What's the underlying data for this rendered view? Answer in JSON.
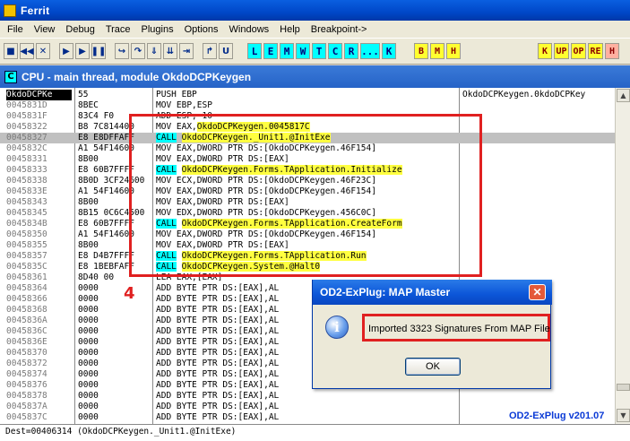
{
  "window": {
    "title": "Ferrit"
  },
  "menu": [
    "File",
    "View",
    "Debug",
    "Trace",
    "Plugins",
    "Options",
    "Windows",
    "Help",
    "Breakpoint->"
  ],
  "toolbar": {
    "letters": [
      "L",
      "E",
      "M",
      "W",
      "T",
      "C",
      "R",
      "...",
      "K"
    ],
    "letters2": [
      "B",
      "M",
      "H"
    ],
    "plugins": [
      "K",
      "UP",
      "OP",
      "RE",
      "H"
    ]
  },
  "cpu": {
    "caption": "CPU - main thread, module OkdoDCPKeygen",
    "rows": [
      {
        "addr": "OkdoDCPKe",
        "hex": "55",
        "asm": "PUSH EBP",
        "cmt": "OkdoDCPKeygen.0kdoDCPKey"
      },
      {
        "addr": "0045831D",
        "hex": "8BEC",
        "asm": "MOV EBP,ESP"
      },
      {
        "addr": "0045831F",
        "hex": "83C4 F0",
        "asm": "ADD ESP,-10"
      },
      {
        "addr": "00458322",
        "hex": "B8 7C814400",
        "asm_pre": "MOV EAX,",
        "asm_tgt": "OkdoDCPKeygen.0045817C"
      },
      {
        "addr": "00458327",
        "hex": "E8 E8DFFAFF",
        "asm_kw": "CALL",
        "asm_tgt": "OkdoDCPKeygen._Unit1.@InitExe"
      },
      {
        "addr": "0045832C",
        "hex": "A1 54F14600",
        "asm": "MOV EAX,DWORD PTR DS:[OkdoDCPKeygen.46F154]"
      },
      {
        "addr": "00458331",
        "hex": "8B00",
        "asm": "MOV EAX,DWORD PTR DS:[EAX]"
      },
      {
        "addr": "00458333",
        "hex": "E8 60B7FFFF",
        "asm_kw": "CALL",
        "asm_tgt": "OkdoDCPKeygen.Forms.TApplication.Initialize"
      },
      {
        "addr": "00458338",
        "hex": "8B0D 3CF24600",
        "asm": "MOV ECX,DWORD PTR DS:[OkdoDCPKeygen.46F23C]"
      },
      {
        "addr": "0045833E",
        "hex": "A1 54F14600",
        "asm": "MOV EAX,DWORD PTR DS:[OkdoDCPKeygen.46F154]"
      },
      {
        "addr": "00458343",
        "hex": "8B00",
        "asm": "MOV EAX,DWORD PTR DS:[EAX]"
      },
      {
        "addr": "00458345",
        "hex": "8B15 0C6C4500",
        "asm": "MOV EDX,DWORD PTR DS:[OkdoDCPKeygen.456C0C]"
      },
      {
        "addr": "0045834B",
        "hex": "E8 60B7FFFF",
        "asm_kw": "CALL",
        "asm_tgt": "OkdoDCPKeygen.Forms.TApplication.CreateForm"
      },
      {
        "addr": "00458350",
        "hex": "A1 54F14600",
        "asm": "MOV EAX,DWORD PTR DS:[OkdoDCPKeygen.46F154]"
      },
      {
        "addr": "00458355",
        "hex": "8B00",
        "asm": "MOV EAX,DWORD PTR DS:[EAX]"
      },
      {
        "addr": "00458357",
        "hex": "E8 D4B7FFFF",
        "asm_kw": "CALL",
        "asm_tgt": "OkdoDCPKeygen.Forms.TApplication.Run"
      },
      {
        "addr": "0045835C",
        "hex": "E8 1BEBFAFF",
        "asm_kw": "CALL",
        "asm_tgt": "OkdoDCPKeygen.System.@Halt0"
      },
      {
        "addr": "00458361",
        "hex": "8D40 00",
        "asm": "LEA EAX,[EAX]"
      },
      {
        "addr": "00458364",
        "hex": "0000",
        "asm": "ADD BYTE PTR DS:[EAX],AL"
      },
      {
        "addr": "00458366",
        "hex": "0000",
        "asm": "ADD BYTE PTR DS:[EAX],AL"
      },
      {
        "addr": "00458368",
        "hex": "0000",
        "asm": "ADD BYTE PTR DS:[EAX],AL"
      },
      {
        "addr": "0045836A",
        "hex": "0000",
        "asm": "ADD BYTE PTR DS:[EAX],AL"
      },
      {
        "addr": "0045836C",
        "hex": "0000",
        "asm": "ADD BYTE PTR DS:[EAX],AL"
      },
      {
        "addr": "0045836E",
        "hex": "0000",
        "asm": "ADD BYTE PTR DS:[EAX],AL"
      },
      {
        "addr": "00458370",
        "hex": "0000",
        "asm": "ADD BYTE PTR DS:[EAX],AL"
      },
      {
        "addr": "00458372",
        "hex": "0000",
        "asm": "ADD BYTE PTR DS:[EAX],AL"
      },
      {
        "addr": "00458374",
        "hex": "0000",
        "asm": "ADD BYTE PTR DS:[EAX],AL"
      },
      {
        "addr": "00458376",
        "hex": "0000",
        "asm": "ADD BYTE PTR DS:[EAX],AL"
      },
      {
        "addr": "00458378",
        "hex": "0000",
        "asm": "ADD BYTE PTR DS:[EAX],AL"
      },
      {
        "addr": "0045837A",
        "hex": "0000",
        "asm": "ADD BYTE PTR DS:[EAX],AL"
      },
      {
        "addr": "0045837C",
        "hex": "0000",
        "asm": "ADD BYTE PTR DS:[EAX],AL"
      }
    ],
    "status": "Dest=00406314 (OkdoDCPKeygen._Unit1.@InitExe)"
  },
  "annotation": {
    "number": "4"
  },
  "dialog": {
    "title": "OD2-ExPlug: MAP Master",
    "message": "Imported 3323 Signatures From MAP File",
    "ok_label": "OK"
  },
  "plugin_version": "OD2-ExPlug v201.07"
}
